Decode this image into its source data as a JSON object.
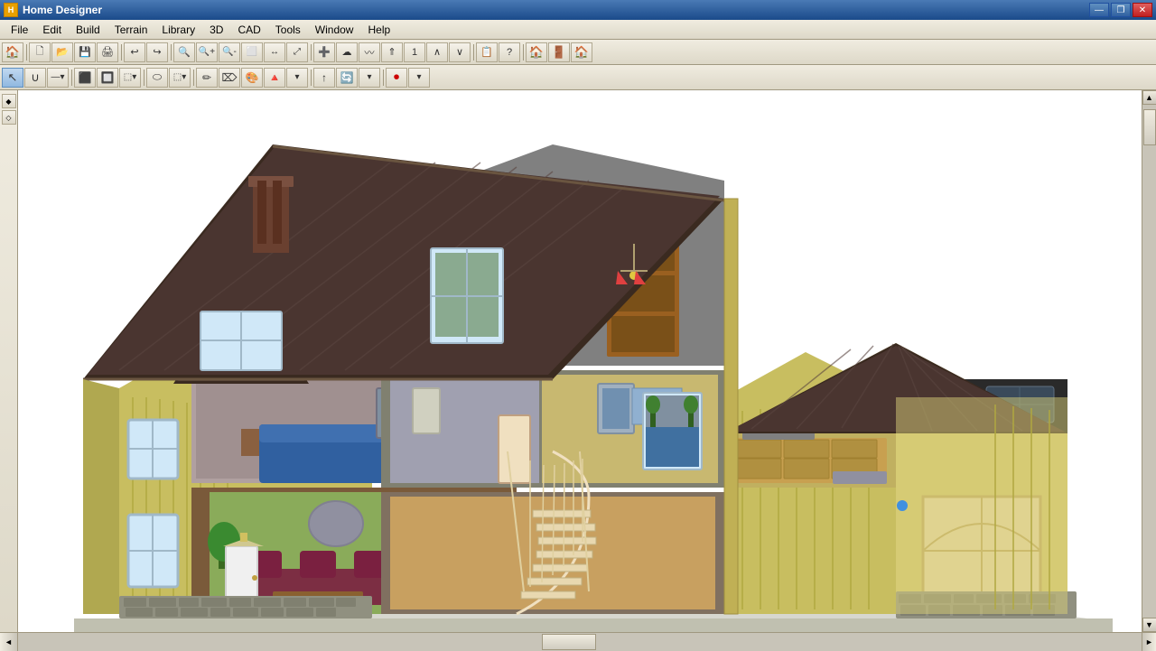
{
  "titlebar": {
    "app_name": "Home Designer",
    "minimize_label": "—",
    "restore_label": "❐",
    "close_label": "✕"
  },
  "menubar": {
    "items": [
      "File",
      "Edit",
      "Build",
      "Terrain",
      "Library",
      "3D",
      "CAD",
      "Tools",
      "Window",
      "Help"
    ]
  },
  "toolbar1": {
    "buttons": [
      "🗋",
      "📂",
      "💾",
      "🖨",
      "↩",
      "↪",
      "🔍",
      "🔍+",
      "🔍-",
      "⬜",
      "↔",
      "⤢",
      "➕",
      "☁",
      "↕",
      "⚡",
      "1",
      "∧",
      "∨",
      "📋",
      "?",
      "🏠",
      "🚪",
      "🏠2"
    ]
  },
  "toolbar2": {
    "buttons": [
      "↖",
      "∪",
      "—",
      "⬛",
      "🔲",
      "⬚",
      "🔘",
      "⬚2",
      "🔺",
      "🔷",
      "↑",
      "🔄",
      "🔴"
    ]
  },
  "bottom": {
    "scroll_left": "◄",
    "scroll_right": "►"
  },
  "right_scroll": {
    "up": "▲",
    "down": "▼"
  },
  "left_panel": {
    "buttons": [
      "◆",
      "◇"
    ]
  }
}
